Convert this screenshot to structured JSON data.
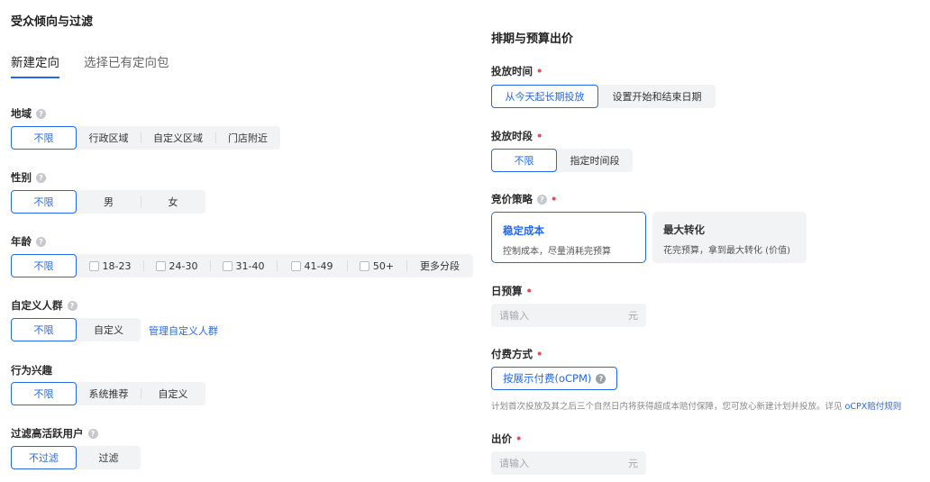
{
  "left": {
    "title": "受众倾向与过滤",
    "tabs": [
      {
        "label": "新建定向",
        "active": true
      },
      {
        "label": "选择已有定向包",
        "active": false
      }
    ],
    "region": {
      "label": "地域",
      "options": [
        "不限",
        "行政区域",
        "自定义区域",
        "门店附近"
      ]
    },
    "gender": {
      "label": "性别",
      "options": [
        "不限",
        "男",
        "女"
      ]
    },
    "age": {
      "label": "年龄",
      "options": [
        "不限",
        "18-23",
        "24-30",
        "31-40",
        "41-49",
        "50+",
        "更多分段"
      ]
    },
    "custom_audience": {
      "label": "自定义人群",
      "options": [
        "不限",
        "自定义"
      ],
      "manage_link": "管理自定义人群"
    },
    "behavior": {
      "label": "行为兴趣",
      "options": [
        "不限",
        "系统推荐",
        "自定义"
      ]
    },
    "filter_active": {
      "label": "过滤高活跃用户",
      "options": [
        "不过滤",
        "过滤"
      ]
    }
  },
  "right": {
    "title": "排期与预算出价",
    "schedule": {
      "label": "投放时间",
      "required": "•",
      "options": [
        "从今天起长期投放",
        "设置开始和结束日期"
      ]
    },
    "time_slot": {
      "label": "投放时段",
      "required": "•",
      "options": [
        "不限",
        "指定时间段"
      ]
    },
    "bid_strategy": {
      "label": "竞价策略",
      "required": "•",
      "cards": [
        {
          "title": "稳定成本",
          "desc": "控制成本，尽量消耗完预算"
        },
        {
          "title": "最大转化",
          "desc": "花完预算，拿到最大转化 (价值)"
        }
      ]
    },
    "daily_budget": {
      "label": "日预算",
      "required": "•",
      "placeholder": "请输入",
      "unit": "元"
    },
    "payment": {
      "label": "付费方式",
      "required": "•",
      "option": "按展示付费(oCPM)"
    },
    "note": {
      "text": "计划首次投放及其之后三个自然日内将获得超成本赔付保障，您可放心新建计划并投放。详见 ",
      "link": "oCPX赔付规则"
    },
    "bid": {
      "label": "出价",
      "required": "•",
      "placeholder": "请输入",
      "unit": "元"
    }
  },
  "colors": {
    "accent": "#2668ea",
    "required": "#e34d59",
    "segment_bg": "#f2f3f5"
  }
}
